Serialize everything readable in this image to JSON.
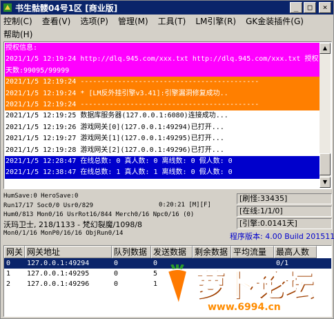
{
  "window": {
    "title": "书生骷髅04号1区 [商业版]",
    "icon": "app-icon",
    "buttons": {
      "minimize": "_",
      "maximize": "□",
      "close": "×"
    }
  },
  "menu": {
    "row1": [
      "控制(C)",
      "查看(V)",
      "选项(P)",
      "管理(M)",
      "工具(T)",
      "LM引擎(R)",
      "GK金装插件(G)"
    ],
    "row2": [
      "帮助(H)"
    ]
  },
  "log": {
    "lines": [
      {
        "text": "授权信息:",
        "style": "magenta"
      },
      {
        "text": "2021/1/5 12:19:24 http://dlq.945.com/xxx.txt http://dlq.945.com/xxx.txt 授权",
        "style": "magenta"
      },
      {
        "text": "天数:99095/99999",
        "style": "magenta"
      },
      {
        "text": "2021/1/5 12:19:24 -------------------------------------------",
        "style": "orange"
      },
      {
        "text": "2021/1/5 12:19:24 * [LM反外挂引擎v3.41]:引擎漏洞修复成功..",
        "style": "orange"
      },
      {
        "text": "2021/1/5 12:19:24 -------------------------------------------",
        "style": "orange"
      },
      {
        "text": "2021/1/5 12:19:25 数据库服务器(127.0.0.1:6080)连接成功...",
        "style": "plain"
      },
      {
        "text": "2021/1/5 12:19:26 游戏网关[0](127.0.0.1:49294)已打开...",
        "style": "plain"
      },
      {
        "text": "2021/1/5 12:19:27 游戏网关[1](127.0.0.1:49295)已打开...",
        "style": "plain"
      },
      {
        "text": "2021/1/5 12:19:28 游戏网关[2](127.0.0.1:49296)已打开...",
        "style": "plain"
      },
      {
        "text": "2021/1/5 12:28:47 在线总数: 0 真人数: 0 离线数: 0 假人数: 0",
        "style": "blue"
      },
      {
        "text": "2021/1/5 12:38:47 在线总数: 1 真人数: 1 离线数: 0 假人数: 0",
        "style": "blue"
      }
    ]
  },
  "stats": {
    "line1": "HumSave:0 HeroSave:0",
    "line2": "Run17/17 Soc0/0 Usr0/829",
    "time": "0:20:21 [M][F]",
    "line3": "Hum0/813 Mon0/16 UsrRot16/844 Merch0/16 Npc0/16 (0)",
    "line4": "沃玛卫士, 218/1133 - 梵幻裂魔/1098/8",
    "line5": "Mon0/1/16 MonP0/16/16 ObjRun0/14"
  },
  "panel": {
    "refresh": "[刷怪:33435]",
    "online": "[在线:1/1/0]",
    "engine": "[引擎:0.0141天]",
    "version": "程序版本: 4.00 Build 20151104"
  },
  "table": {
    "headers": [
      "网关",
      "网关地址",
      "队列数据",
      "发送数据",
      "剩余数据",
      "平均流量",
      "最高人数"
    ],
    "rows": [
      [
        "0",
        "127.0.0.1:49294",
        "0",
        "0",
        "",
        "",
        "0/1"
      ],
      [
        "1",
        "127.0.0.1:49295",
        "0",
        "5",
        "",
        "",
        ""
      ],
      [
        "2",
        "127.0.0.1:49296",
        "0",
        "1",
        "",
        "",
        ""
      ]
    ]
  },
  "watermark": {
    "brand": "萝卜论坛",
    "url": "www.6994.cn"
  }
}
